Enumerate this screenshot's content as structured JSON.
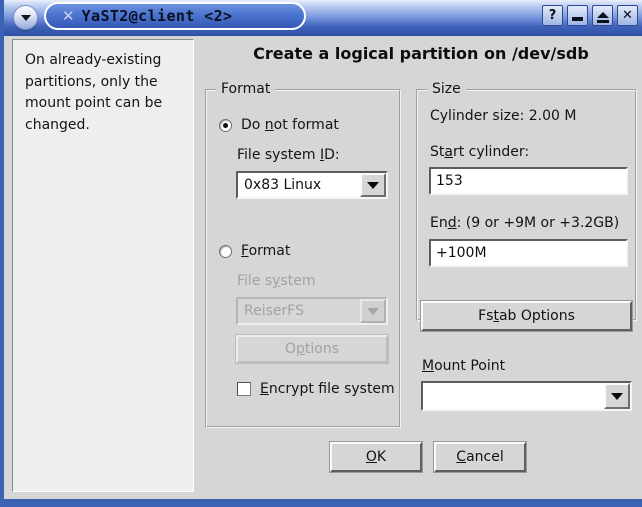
{
  "window": {
    "title": "YaST2@client <2>",
    "menu_icon": "chevron-down-icon",
    "buttons": [
      {
        "name": "help-button",
        "glyph": "?"
      },
      {
        "name": "minimize-button",
        "glyph": "–"
      },
      {
        "name": "maximize-button",
        "glyph": "▲"
      },
      {
        "name": "close-button",
        "glyph": "✕"
      }
    ]
  },
  "help": {
    "text": "On already-existing partitions, only the mount point can be changed."
  },
  "main": {
    "heading": "Create a logical partition on /dev/sdb"
  },
  "format_group": {
    "title": "Format",
    "do_not_format": {
      "label_pre": "Do ",
      "label_key": "n",
      "label_post": "ot format",
      "selected": true
    },
    "fs_id_label_pre": "File system ",
    "fs_id_label_key": "I",
    "fs_id_label_post": "D:",
    "fs_id_value": "0x83 Linux",
    "format": {
      "label_pre": "",
      "label_key": "F",
      "label_post": "ormat",
      "selected": false
    },
    "fs_label_pre": "File s",
    "fs_label_key": "y",
    "fs_label_post": "stem",
    "fs_value": "ReiserFS",
    "options_label_pre": "O",
    "options_label_key": "p",
    "options_label_post": "tions",
    "encrypt": {
      "label_pre": "",
      "label_key": "E",
      "label_post": "ncrypt file system",
      "checked": false
    }
  },
  "size_group": {
    "title": "Size",
    "cylinder_size": "Cylinder size: 2.00 M",
    "start_cylinder_label_pre": "St",
    "start_cylinder_label_key": "a",
    "start_cylinder_label_post": "rt cylinder:",
    "start_cylinder_value": "153",
    "end_label_pre": "En",
    "end_label_key": "d",
    "end_label_post": ":  (9 or +9M or +3.2GB)",
    "end_value": "+100M"
  },
  "fstab": {
    "label_pre": "Fs",
    "label_key": "t",
    "label_post": "ab Options"
  },
  "mount_point": {
    "label_pre": "",
    "label_key": "M",
    "label_post": "ount Point",
    "value": ""
  },
  "actions": {
    "ok_pre": "",
    "ok_key": "O",
    "ok_post": "K",
    "cancel_pre": "",
    "cancel_key": "C",
    "cancel_post": "ancel"
  },
  "colors": {
    "titlebar_blue": "#3557b6",
    "frame_blue": "#3b63b4",
    "dialog_gray": "#d6d6d6",
    "help_panel": "#eeeeee",
    "field_white": "#ffffff"
  }
}
